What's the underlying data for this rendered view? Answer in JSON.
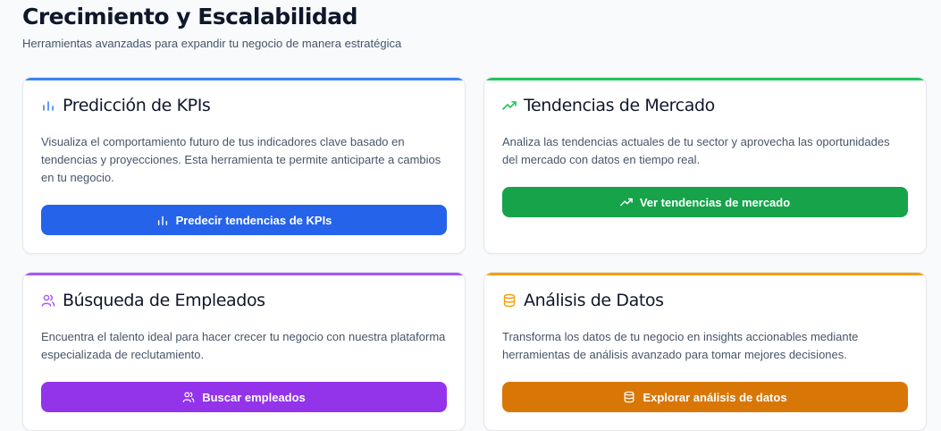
{
  "header": {
    "title": "Crecimiento y Escalabilidad",
    "subtitle": "Herramientas avanzadas para expandir tu negocio de manera estratégica"
  },
  "cards": [
    {
      "title": "Predicción de KPIs",
      "description": "Visualiza el comportamiento futuro de tus indicadores clave basado en tendencias y proyecciones. Esta herramienta te permite anticiparte a cambios en tu negocio.",
      "button_label": "Predecir tendencias de KPIs",
      "icon": "bar-chart-icon",
      "accent_color": "#3b82f6",
      "button_color": "#2563eb"
    },
    {
      "title": "Tendencias de Mercado",
      "description": "Analiza las tendencias actuales de tu sector y aprovecha las oportunidades del mercado con datos en tiempo real.",
      "button_label": "Ver tendencias de mercado",
      "icon": "trending-up-icon",
      "accent_color": "#22c55e",
      "button_color": "#16a34a"
    },
    {
      "title": "Búsqueda de Empleados",
      "description": "Encuentra el talento ideal para hacer crecer tu negocio con nuestra plataforma especializada de reclutamiento.",
      "button_label": "Buscar empleados",
      "icon": "users-icon",
      "accent_color": "#a855f7",
      "button_color": "#9333ea"
    },
    {
      "title": "Análisis de Datos",
      "description": "Transforma los datos de tu negocio en insights accionables mediante herramientas de análisis avanzado para tomar mejores decisiones.",
      "button_label": "Explorar análisis de datos",
      "icon": "database-icon",
      "accent_color": "#f59e0b",
      "button_color": "#d97706"
    }
  ]
}
